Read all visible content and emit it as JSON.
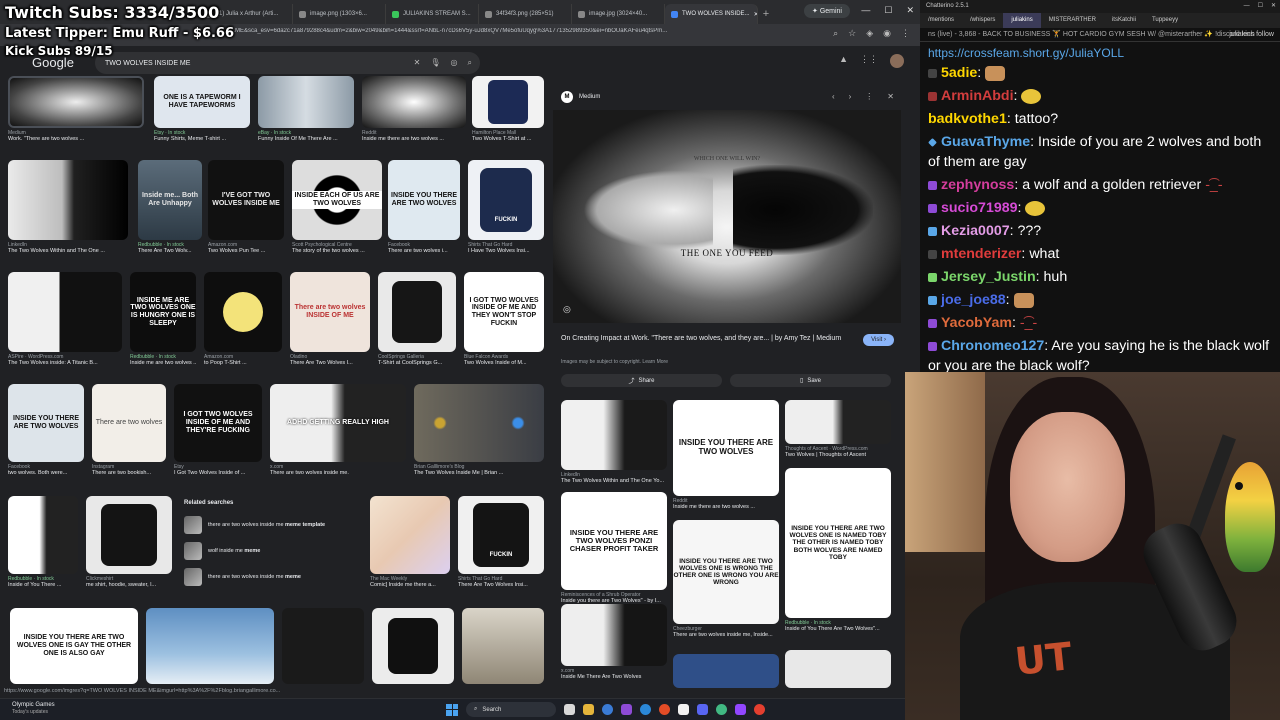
{
  "overlay": {
    "subs": "Twitch Subs: 3334/3500",
    "tipper": "Latest Tipper: Emu Ruff - $6.66",
    "kick": "Kick Subs 89/15"
  },
  "browser": {
    "tabs": [
      {
        "label": "(1) Julia x Arthur (Arti..."
      },
      {
        "label": "image.png (1303×6..."
      },
      {
        "label": "JULIAKINS STREAM S..."
      },
      {
        "label": "34f34f3.png (285×51)"
      },
      {
        "label": "image.jpg (3024×40..."
      },
      {
        "label": "TWO WOLVES INSIDE..."
      }
    ],
    "gemini": "Gemini",
    "url": "...ME&sca_esv=6da2c71a879288c4&udm=2&biw=2049&bih=1444&ssrf=ANbL-n7cDs6V5y-uJd8xQV7Me5ofuUqyg%3A1771352989350&ei=nbOUaKAFeu4qtsPm..."
  },
  "google": {
    "logo": "Google",
    "query": "TWO WOLVES INSIDE ME"
  },
  "grid": {
    "row1": [
      {
        "src": "Medium",
        "cap": "Work. \"There are two wolves ..."
      },
      {
        "src": "Etsy · In stock",
        "cap": "Funny Shirts, Meme T-shirt ...",
        "thumb": "ONE IS A TAPEWORM I HAVE TAPEWORMS"
      },
      {
        "src": "eBay · In stock",
        "cap": "Funny Inside Of Me There Are ..."
      },
      {
        "src": "Reddit",
        "cap": "Inside me there are two wolves ..."
      },
      {
        "src": "Hamilton Place Mall",
        "cap": "Two Wolves T-Shirt at ..."
      }
    ],
    "row2": [
      {
        "src": "LinkedIn",
        "cap": "The Two Wolves Within and The One ..."
      },
      {
        "src": "Redbubble · In stock",
        "cap": "There Are Two Wolv...",
        "thumb": "Inside me... Both Are Unhappy"
      },
      {
        "src": "Amazon.com",
        "cap": "Two Wolves Pun Tee ...",
        "thumb": "I'VE GOT TWO WOLVES INSIDE ME"
      },
      {
        "src": "Scott Psychological Centre",
        "cap": "The story of the two wolves ...",
        "thumb": "INSIDE EACH OF US ARE TWO WOLVES"
      },
      {
        "src": "Facebook",
        "cap": "There are two wolves i...",
        "thumb": "INSIDE YOU THERE ARE TWO WOLVES"
      },
      {
        "src": "Shirts That Go Hard",
        "cap": "I Have Two Wolves Insi...",
        "thumb": "FUCKIN"
      }
    ],
    "row3": [
      {
        "src": "ASPire · WordPress.com",
        "cap": "The Two Wolves inside: A Titanic B..."
      },
      {
        "src": "Redbubble · In stock",
        "cap": "Inside me are two wolves ...",
        "thumb": "INSIDE ME ARE TWO WOLVES ONE IS HUNGRY ONE IS SLEEPY"
      },
      {
        "src": "Amazon.com",
        "cap": "to Poop T-Shirt ..."
      },
      {
        "src": "Oladino",
        "cap": "There Are Two Wolves I...",
        "thumb": "There are two wolves INSIDE OF ME"
      },
      {
        "src": "CoolSprings Galleria",
        "cap": "T-Shirt at CoolSprings G..."
      },
      {
        "src": "Blue Falcon Awards",
        "cap": "Two Wolves Inside of M...",
        "thumb": "I GOT TWO WOLVES INSIDE OF ME AND THEY WON'T STOP FUCKIN"
      }
    ],
    "row4": [
      {
        "src": "Facebook",
        "cap": "two wolves. Both were...",
        "thumb": "INSIDE YOU THERE ARE TWO WOLVES"
      },
      {
        "src": "Instagram",
        "cap": "There are two bookish...",
        "thumb": "There are two wolves"
      },
      {
        "src": "Etsy",
        "cap": "I Got Two Wolves Inside of ...",
        "thumb": "I GOT TWO WOLVES INSIDE OF ME AND THEY'RE FUCKING"
      },
      {
        "src": "x.com",
        "cap": "There are two wolves inside me.",
        "thumb": "ADHD GETTING REALLY HIGH"
      },
      {
        "src": "Brian Galllimore's Blog",
        "cap": "The Two Wolves Inside Me | Brian ..."
      }
    ],
    "row5": [
      {
        "src": "Redbubble · In stock",
        "cap": "Inside of You There ..."
      },
      {
        "src": "Clickmeshirt",
        "cap": "me shirt, hoodie, sweater, l..."
      },
      {
        "src": "The Mac Weekly",
        "cap": "Comic] Inside me there a..."
      },
      {
        "src": "Shirts That Go Hard",
        "cap": "There Are Two Wolves Insi...",
        "thumb": "FUCKIN"
      }
    ],
    "row6": [
      {
        "thumb": "INSIDE YOU THERE ARE TWO WOLVES ONE IS GAY THE OTHER ONE IS ALSO GAY"
      },
      {
        "thumb": ""
      },
      {
        "thumb": ""
      },
      {
        "thumb": ""
      },
      {
        "thumb": ""
      }
    ]
  },
  "related": {
    "title": "Related searches",
    "items": [
      {
        "pre": "there are two wolves inside me ",
        "bold": "meme template"
      },
      {
        "pre": "wolf inside me ",
        "bold": "meme"
      },
      {
        "pre": "there are two wolves inside me ",
        "bold": "meme"
      }
    ]
  },
  "panel": {
    "source": "Medium",
    "image_top_text": "WHICH ONE WILL WIN?",
    "image_main_text": "THE ONE YOU FEED",
    "title": "On Creating Impact at Work. \"There are two wolves, and they are... | by Amy Tez | Medium",
    "visit": "Visit",
    "note": "Images may be subject to copyright. Learn More",
    "share": "Share",
    "save": "Save",
    "related_images": [
      {
        "src": "LinkedIn",
        "cap": "The Two Wolves Within and The One Yo..."
      },
      {
        "src": "Reddit",
        "cap": "Inside me there are two wolves ...",
        "thumb": "INSIDE YOU THERE ARE TWO WOLVES"
      },
      {
        "src": "Thoughts of Ascent · WordPress.com",
        "cap": "Two Wolves | Thoughts of Ascent"
      },
      {
        "src": "Reminiscences of a Shrub Operator",
        "cap": "Inside you there are Two Wolves\" - by I...",
        "thumb": "INSIDE YOU THERE ARE TWO WOLVES PONZI CHASER PROFIT TAKER"
      },
      {
        "src": "Cheezburger",
        "cap": "There are two wolves inside me, Inside...",
        "thumb": "INSIDE YOU THERE ARE TWO WOLVES ONE IS WRONG THE OTHER ONE IS WRONG YOU ARE WRONG"
      },
      {
        "src": "Redbubble · In stock",
        "cap": "Inside of You There Are Two Wolves\"...",
        "thumb": "INSIDE YOU THERE ARE TWO WOLVES ONE IS NAMED TOBY THE OTHER IS NAMED TOBY BOTH WOLVES ARE NAMED TOBY"
      },
      {
        "src": "x.com",
        "cap": "Inside Me There Are Two Wolves"
      }
    ]
  },
  "statusbar": "https://www.google.com/imgres?q=TWO WOLVES INSIDE ME&imgurl=http%3A%2F%2Fblog.briangallimore.co...",
  "taskbar": {
    "weather_title": "Olympic Games",
    "weather_sub": "Today's updates",
    "search": "Search"
  },
  "chat": {
    "app_title": "Chatterino 2.5.1",
    "tabs": [
      "/mentions",
      "/whispers",
      "juliakins",
      "MISTERARTHER",
      "itsKatchii",
      "Tuppeeyy"
    ],
    "notice": "ns (live) - 3,868 - BACK TO BUSINESS 🏋 HOT CARDIO GYM SESH W/ @misterarther ✨ !discord tech",
    "notice_right": "juliakins  follow",
    "link_line": "https://crossfeam.short.gy/JuliaYOLL",
    "messages": [
      {
        "user": "5adie",
        "color": "#ffd700",
        "text": ""
      },
      {
        "user": "ArminAbdi",
        "color": "#d33d3d",
        "text": ""
      },
      {
        "user": "badkvothe1",
        "color": "#ffd700",
        "text": "tattoo?"
      },
      {
        "user": "GuavaThyme",
        "color": "#5aa7e8",
        "text": "Inside of you are 2 wolves and both of them are gay"
      },
      {
        "user": "zephynoss",
        "color": "#d33d9c",
        "text": "a wolf and a golden retriever"
      },
      {
        "user": "sucio71989",
        "color": "#d64bd6",
        "text": ""
      },
      {
        "user": "Kezia0007",
        "color": "#e39ce6",
        "text": "???"
      },
      {
        "user": "mtenderizer",
        "color": "#e03c3c",
        "text": "what"
      },
      {
        "user": "Jersey_Justin",
        "color": "#7bd66b",
        "text": "huh"
      },
      {
        "user": "joe_joe88",
        "color": "#4a6ce8",
        "text": ""
      },
      {
        "user": "YacobYam",
        "color": "#e06b3c",
        "text": ""
      },
      {
        "user": "Chronomeo127",
        "color": "#5aa7e8",
        "text": "Are you saying he is the black wolf or you are the black wolf?"
      }
    ]
  },
  "webcam": {
    "shirt_text": "UT"
  },
  "colors": {
    "accent_link": "#8ab4f8",
    "in_stock": "#81c995"
  }
}
